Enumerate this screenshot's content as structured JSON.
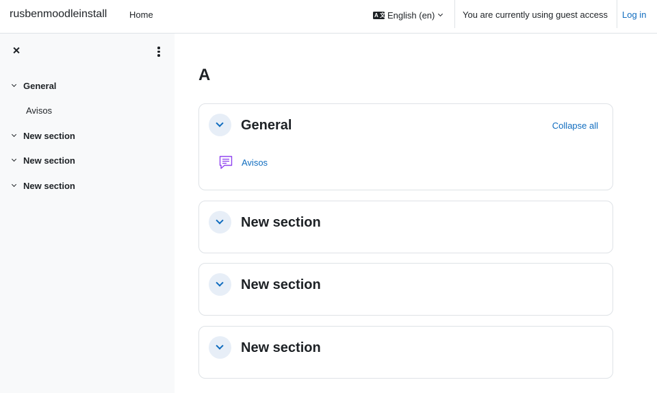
{
  "navbar": {
    "brand": "rusbenmoodleinstall",
    "home": "Home",
    "language": "English ‎(en)‎",
    "guest_notice": "You are currently using guest access",
    "login": "Log in"
  },
  "drawer": {
    "close_icon": "close-icon",
    "menu_icon": "kebab-icon",
    "sections": [
      {
        "title": "General",
        "activities": [
          "Avisos"
        ]
      },
      {
        "title": "New section",
        "activities": []
      },
      {
        "title": "New section",
        "activities": []
      },
      {
        "title": "New section",
        "activities": []
      }
    ]
  },
  "main": {
    "course_title": "A",
    "collapse_all": "Collapse all",
    "sections": [
      {
        "title": "General",
        "activities": [
          {
            "name": "Avisos",
            "icon": "forum-icon"
          }
        ]
      },
      {
        "title": "New section"
      },
      {
        "title": "New section"
      },
      {
        "title": "New section"
      }
    ]
  },
  "colors": {
    "link": "#0f6cbf",
    "drawer_bg": "#f8f9fa",
    "forum_icon": "#8f42ef",
    "toggle_bg": "#e7eef7"
  }
}
